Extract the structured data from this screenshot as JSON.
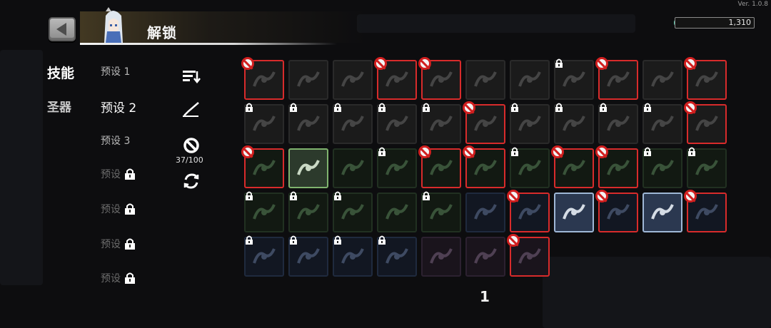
{
  "version": "Ver. 1.0.8",
  "header": {
    "title": "解锁"
  },
  "currency": {
    "value": "1,310"
  },
  "tabs": {
    "skills": "技能",
    "relics": "圣器"
  },
  "presets": [
    {
      "label": "预设 1",
      "state": "normal"
    },
    {
      "label": "预设 2",
      "state": "active"
    },
    {
      "label": "预设 3",
      "state": "normal"
    },
    {
      "label": "预设",
      "state": "locked"
    },
    {
      "label": "预设",
      "state": "locked"
    },
    {
      "label": "预设",
      "state": "locked"
    },
    {
      "label": "预设",
      "state": "locked"
    }
  ],
  "tools": {
    "ban_count": "37/100"
  },
  "page": {
    "number": "1"
  },
  "colors": {
    "ban_red": "#d82b2b",
    "owned_green": "#7fb36e",
    "owned_blue": "#9fb7d6",
    "gem": "#3cc7a0"
  },
  "skill_grid": [
    [
      "gray:banned",
      "gray",
      "gray",
      "gray:banned",
      "gray:banned",
      "gray",
      "gray",
      "gray:locked",
      "gray:banned",
      "gray",
      "gray:banned"
    ],
    [
      "gray:locked",
      "gray:locked",
      "gray:locked",
      "gray:locked",
      "gray:locked",
      "gray:banned",
      "gray:locked",
      "gray:locked",
      "gray:locked",
      "gray:locked",
      "gray:banned"
    ],
    [
      "green:banned",
      "owned-green",
      "green",
      "green:locked",
      "green:banned",
      "green:banned",
      "green:locked",
      "green:banned",
      "green:banned",
      "green:locked",
      "green:locked"
    ],
    [
      "green:locked",
      "green:locked",
      "green:locked",
      "green",
      "green:locked",
      "blue",
      "blue:banned",
      "owned-blue",
      "blue:banned",
      "owned-blue",
      "blue:banned"
    ],
    [
      "blue:locked",
      "blue:locked",
      "blue:locked",
      "blue:locked",
      "purple",
      "purple",
      "purple:banned"
    ]
  ]
}
